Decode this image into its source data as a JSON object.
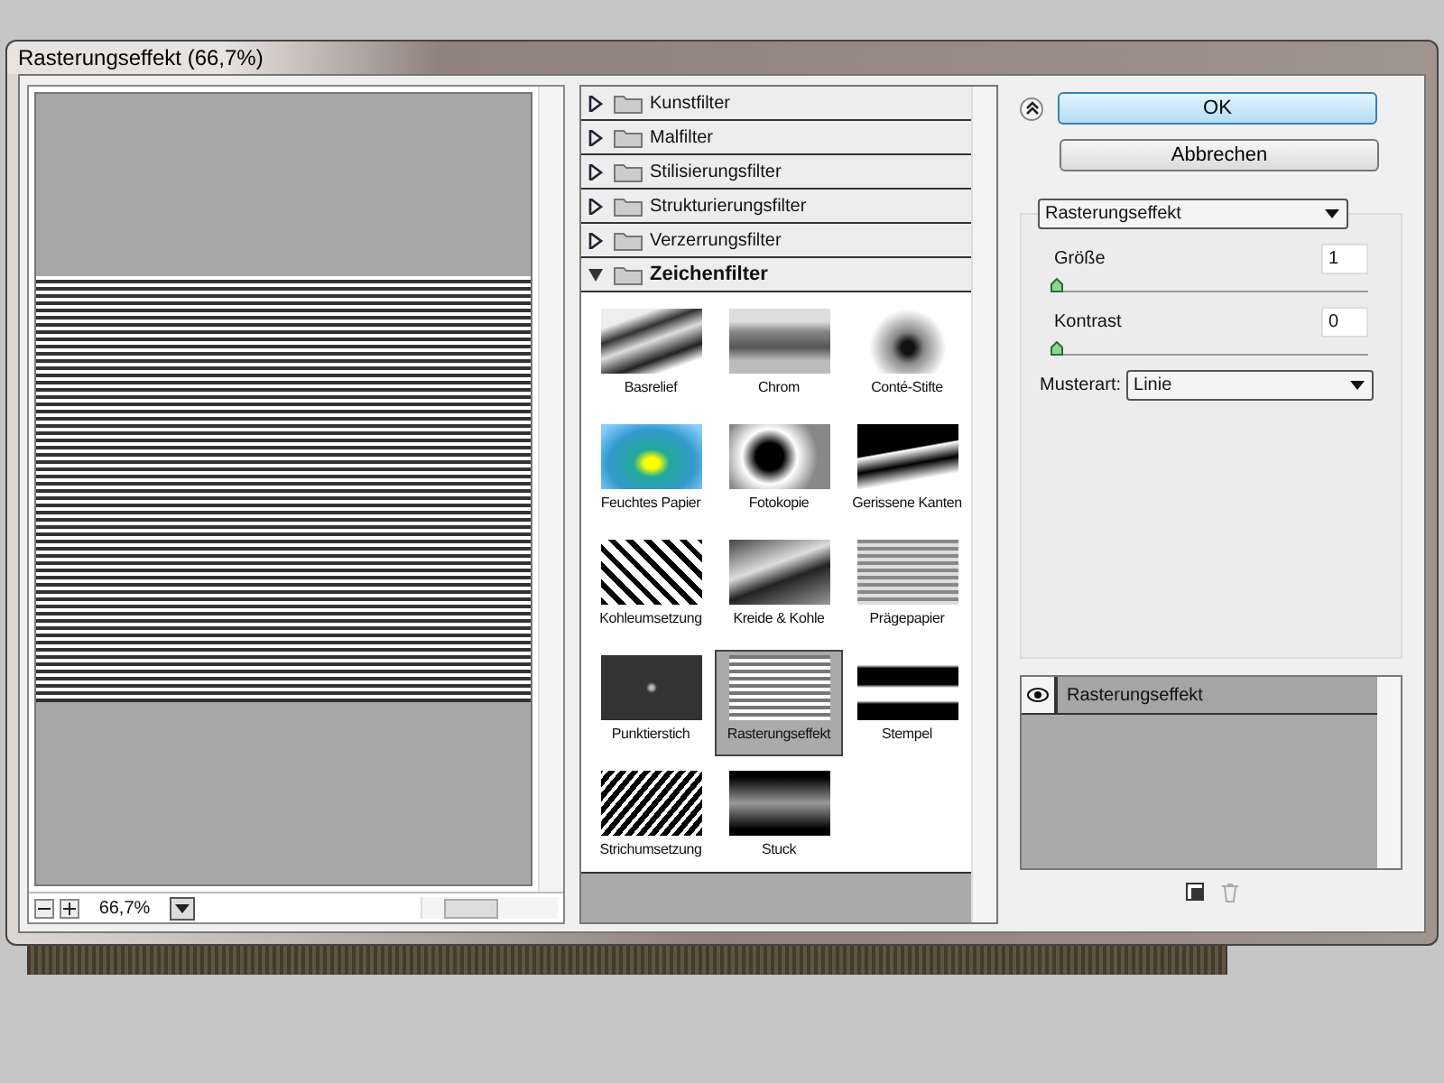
{
  "window": {
    "title": "Rasterungseffekt (66,7%)"
  },
  "preview": {
    "zoom": "66,7%"
  },
  "categories": [
    {
      "label": "Kunstfilter",
      "expanded": false
    },
    {
      "label": "Malfilter",
      "expanded": false
    },
    {
      "label": "Stilisierungsfilter",
      "expanded": false
    },
    {
      "label": "Strukturierungsfilter",
      "expanded": false
    },
    {
      "label": "Verzerrungsfilter",
      "expanded": false
    },
    {
      "label": "Zeichenfilter",
      "expanded": true,
      "filters": [
        {
          "label": "Basrelief",
          "selected": false
        },
        {
          "label": "Chrom",
          "selected": false
        },
        {
          "label": "Conté-Stifte",
          "selected": false
        },
        {
          "label": "Feuchtes Papier",
          "selected": false
        },
        {
          "label": "Fotokopie",
          "selected": false
        },
        {
          "label": "Gerissene Kanten",
          "selected": false
        },
        {
          "label": "Kohleumsetzung",
          "selected": false
        },
        {
          "label": "Kreide & Kohle",
          "selected": false
        },
        {
          "label": "Prägepapier",
          "selected": false
        },
        {
          "label": "Punktierstich",
          "selected": false
        },
        {
          "label": "Rasterungseffekt",
          "selected": true
        },
        {
          "label": "Stempel",
          "selected": false
        },
        {
          "label": "Strichumsetzung",
          "selected": false
        },
        {
          "label": "Stuck",
          "selected": false
        }
      ]
    }
  ],
  "buttons": {
    "ok": "OK",
    "cancel": "Abbrechen"
  },
  "effect_select": {
    "value": "Rasterungseffekt"
  },
  "sliders": [
    {
      "label": "Größe",
      "value": "1",
      "level": 0
    },
    {
      "label": "Kontrast",
      "value": "0",
      "level": 0
    }
  ],
  "pattern": {
    "label": "Musterart:",
    "value": "Linie"
  },
  "layers": [
    {
      "label": "Rasterungseffekt",
      "visible": true
    }
  ]
}
